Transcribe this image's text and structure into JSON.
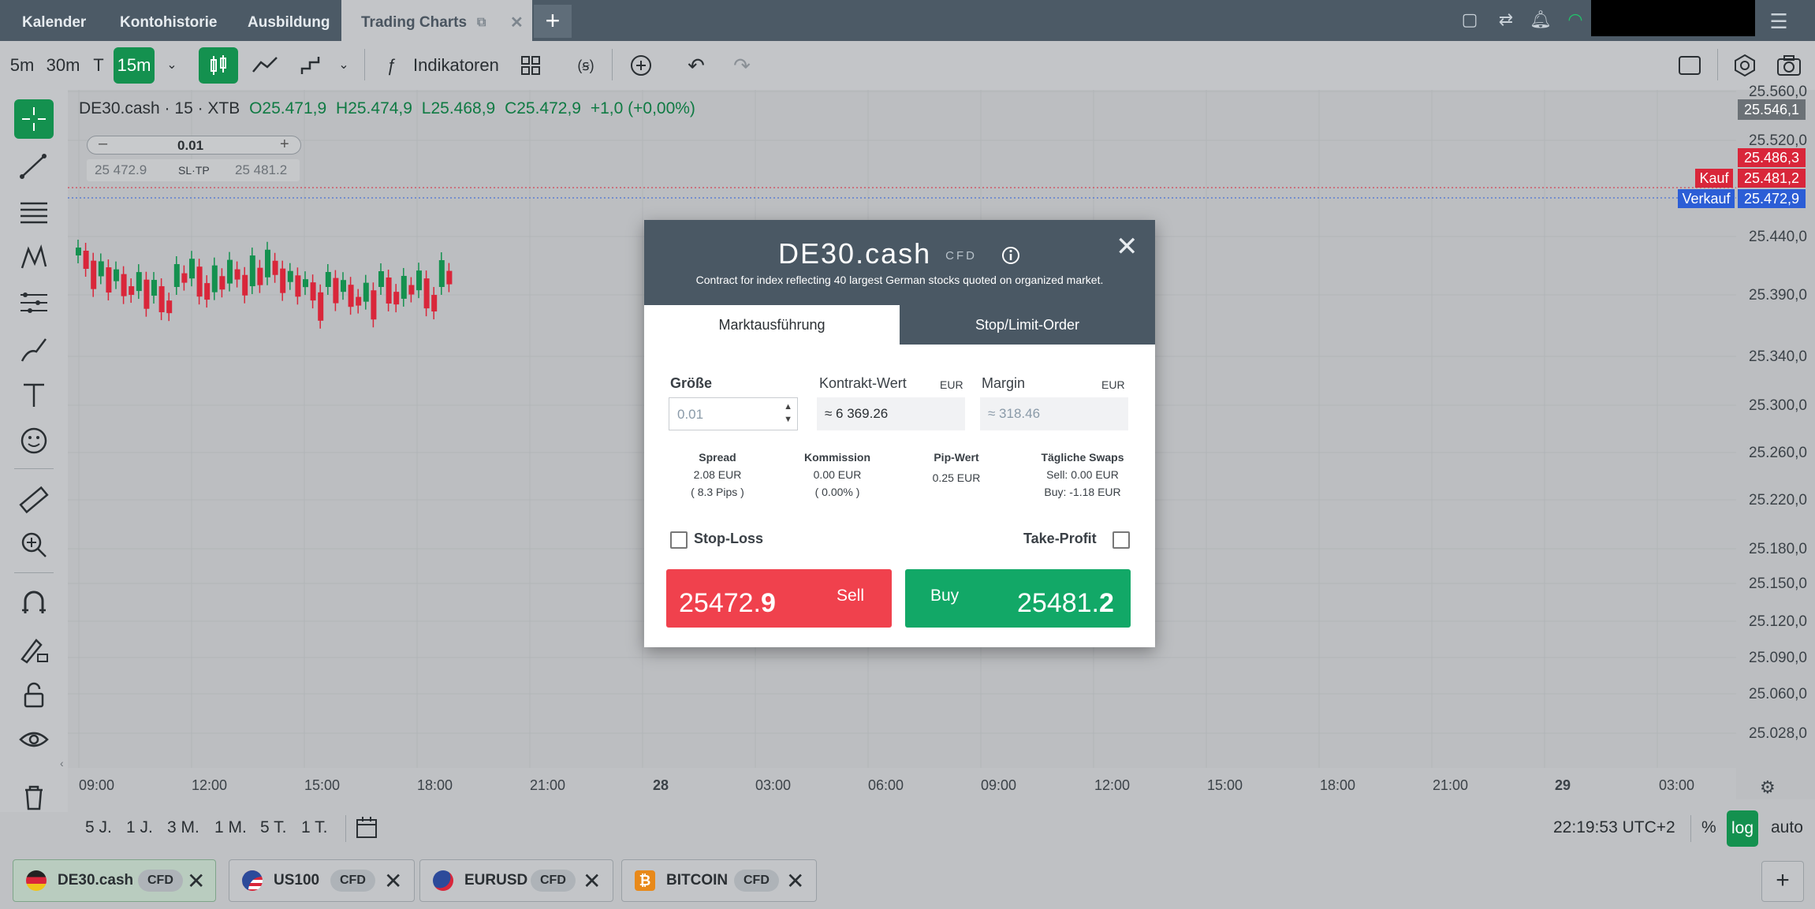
{
  "tabs": [
    "Kalender",
    "Kontohistorie",
    "Ausbildung",
    "Trading Charts"
  ],
  "toolbar": {
    "intervals": [
      "5m",
      "30m",
      "T",
      "15m"
    ],
    "indicators_label": "Indikatoren"
  },
  "symbol": {
    "title": "DE30.cash · 15 · XTB",
    "open": "O25.471,9",
    "high": "H25.474,9",
    "low": "L25.468,9",
    "close": "C25.472,9",
    "change": "+1,0 (+0,00%)"
  },
  "quick_trade": {
    "size": "0.01",
    "sell_price": "25 472.9",
    "sltp": "SL·TP",
    "buy_price": "25 481.2"
  },
  "price_axis": {
    "labels": [
      "25.560,0",
      "25.520,0",
      "25.440,0",
      "25.390,0",
      "25.340,0",
      "25.300,0",
      "25.260,0",
      "25.220,0",
      "25.180,0",
      "25.150,0",
      "25.120,0",
      "25.090,0",
      "25.060,0",
      "25.028,0"
    ],
    "top_badge": "25.546,1",
    "red_badge": "25.486,3",
    "kauf_label": "Kauf",
    "kauf_price": "25.481,2",
    "verkauf_label": "Verkauf",
    "verkauf_price": "25.472,9"
  },
  "time_axis": [
    "09:00",
    "12:00",
    "15:00",
    "18:00",
    "21:00",
    "28",
    "03:00",
    "06:00",
    "09:00",
    "12:00",
    "15:00",
    "18:00",
    "21:00",
    "29",
    "03:00"
  ],
  "ranges": [
    "5 J.",
    "1 J.",
    "3 M.",
    "1 M.",
    "5 T.",
    "1 T."
  ],
  "clock": "22:19:53 UTC+2",
  "scale_options": [
    "%",
    "log",
    "auto"
  ],
  "instruments": [
    {
      "name": "DE30.cash",
      "tag": "CFD"
    },
    {
      "name": "US100",
      "tag": "CFD"
    },
    {
      "name": "EURUSD",
      "tag": "CFD"
    },
    {
      "name": "BITCOIN",
      "tag": "CFD"
    }
  ],
  "modal": {
    "title": "DE30.cash",
    "tag": "CFD",
    "description": "Contract for index reflecting 40 largest German stocks quoted on organized market.",
    "tab_market": "Marktausführung",
    "tab_limit": "Stop/Limit-Order",
    "size_label": "Größe",
    "size_value": "0.01",
    "contract_label": "Kontrakt-Wert",
    "contract_unit": "EUR",
    "contract_value": "≈ 6 369.26",
    "margin_label": "Margin",
    "margin_unit": "EUR",
    "margin_value": "≈  318.46",
    "spread_label": "Spread",
    "spread_value": "2.08 EUR",
    "spread_pips": "( 8.3 Pips )",
    "commission_label": "Kommission",
    "commission_value": "0.00 EUR",
    "commission_pct": "( 0.00% )",
    "pip_label": "Pip-Wert",
    "pip_value": "0.25 EUR",
    "swaps_label": "Tägliche Swaps",
    "swaps_sell": "Sell: 0.00 EUR",
    "swaps_buy": "Buy: -1.18 EUR",
    "stoploss_label": "Stop-Loss",
    "takeprofit_label": "Take-Profit",
    "sell_label": "Sell",
    "sell_price_main": "25472.",
    "sell_price_last": "9",
    "buy_label": "Buy",
    "buy_price_main": "25481.",
    "buy_price_last": "2"
  },
  "colors": {
    "header_bg": "#4c5a66",
    "bull": "#14914f",
    "bear": "#d9263a",
    "sell_button": "#f0414d",
    "buy_button": "#12a867"
  }
}
